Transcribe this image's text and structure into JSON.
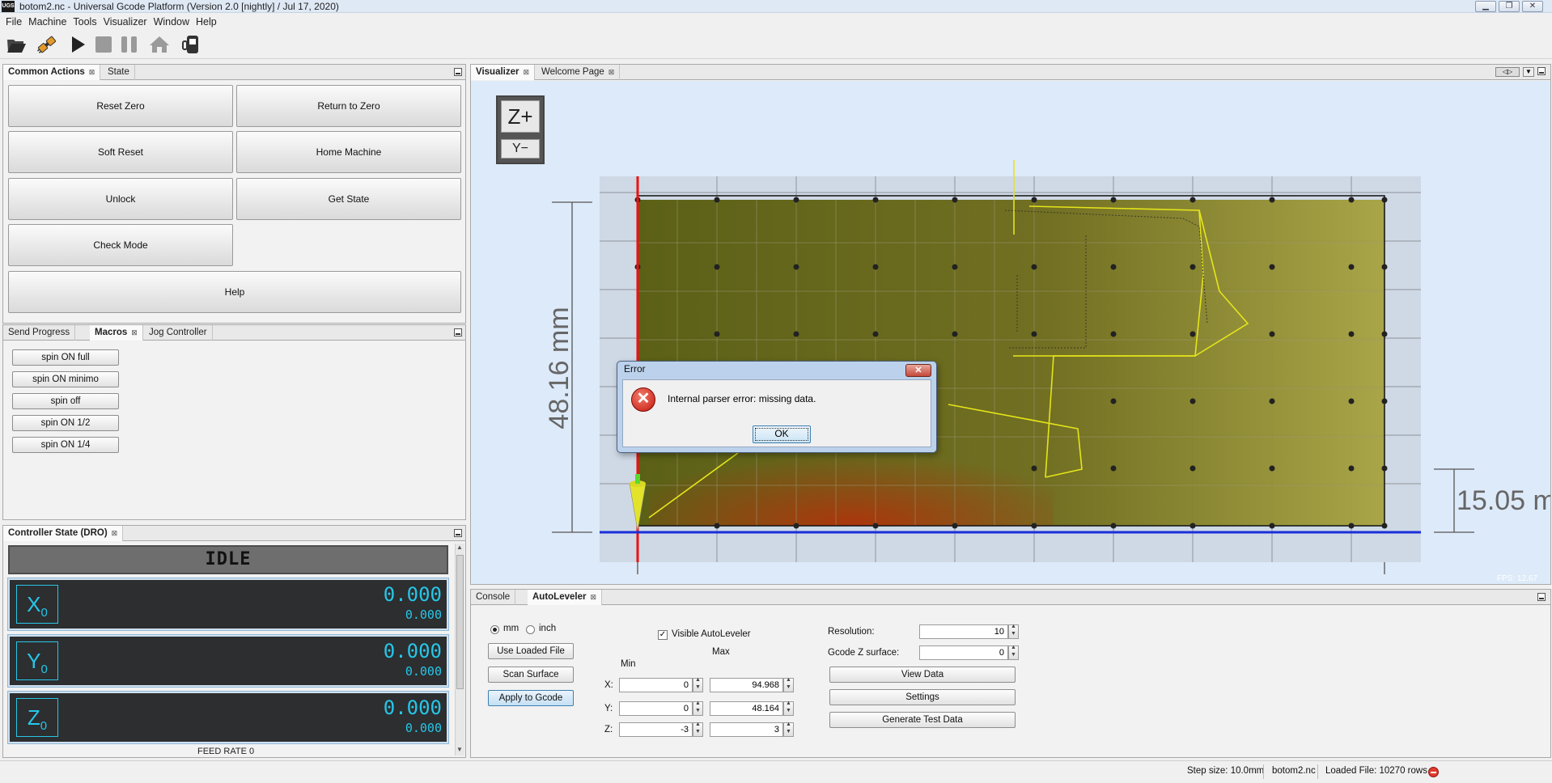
{
  "window": {
    "title": "botom2.nc - Universal Gcode Platform (Version 2.0 [nightly]  / Jul 17, 2020)",
    "app_icon_text": "UGS"
  },
  "menu": [
    "File",
    "Machine",
    "Tools",
    "Visualizer",
    "Window",
    "Help"
  ],
  "toolbar": {
    "icons": [
      "open-file-icon",
      "connect-icon",
      "play-icon",
      "stop-icon",
      "pause-icon",
      "home-icon",
      "pendant-icon"
    ]
  },
  "common_actions": {
    "tabs": [
      "Common Actions",
      "State"
    ],
    "buttons": {
      "reset_zero": "Reset Zero",
      "return_to_zero": "Return to Zero",
      "soft_reset": "Soft Reset",
      "home_machine": "Home Machine",
      "unlock": "Unlock",
      "get_state": "Get State",
      "check_mode": "Check Mode",
      "help": "Help"
    }
  },
  "macros_panel": {
    "tabs": [
      "Send Progress",
      "Macros",
      "Jog Controller"
    ],
    "macros": [
      "spin ON full",
      "spin ON minimo",
      "spin off",
      "spin ON 1/2",
      "spin ON 1/4"
    ]
  },
  "dro": {
    "tab": "Controller State (DRO)",
    "state": "IDLE",
    "axes": [
      {
        "name": "X",
        "sub": "0",
        "work": "0.000",
        "machine": "0.000"
      },
      {
        "name": "Y",
        "sub": "0",
        "work": "0.000",
        "machine": "0.000"
      },
      {
        "name": "Z",
        "sub": "0",
        "work": "0.000",
        "machine": "0.000"
      }
    ],
    "feed_label": "FEED RATE 0"
  },
  "visualizer": {
    "tabs": [
      "Visualizer",
      "Welcome Page"
    ],
    "orientation": {
      "top": "Z+",
      "bottom": "Y−"
    },
    "dim_height": "48.16 mm",
    "dim_right": "15.05 m",
    "fps": "FPS: 12.67"
  },
  "bottom_panel": {
    "tabs": [
      "Console",
      "AutoLeveler"
    ],
    "units": {
      "mm": "mm",
      "inch": "inch"
    },
    "buttons": {
      "use_loaded": "Use Loaded File",
      "scan": "Scan Surface",
      "apply": "Apply to Gcode",
      "view_data": "View Data",
      "settings": "Settings",
      "generate": "Generate Test Data"
    },
    "visible_autoleveler": "Visible AutoLeveler",
    "min_label": "Min",
    "max_label": "Max",
    "rows": [
      {
        "label": "X:",
        "min": "0",
        "max": "94.968"
      },
      {
        "label": "Y:",
        "min": "0",
        "max": "48.164"
      },
      {
        "label": "Z:",
        "min": "-3",
        "max": "3"
      }
    ],
    "resolution_label": "Resolution:",
    "resolution": "10",
    "gcode_z_label": "Gcode Z surface:",
    "gcode_z": "0"
  },
  "dialog": {
    "title": "Error",
    "message": "Internal parser error: missing data.",
    "ok": "OK"
  },
  "statusbar": {
    "step": "Step size: 10.0mm",
    "file": "botom2.nc",
    "loaded": "Loaded File: 10270 rows"
  }
}
